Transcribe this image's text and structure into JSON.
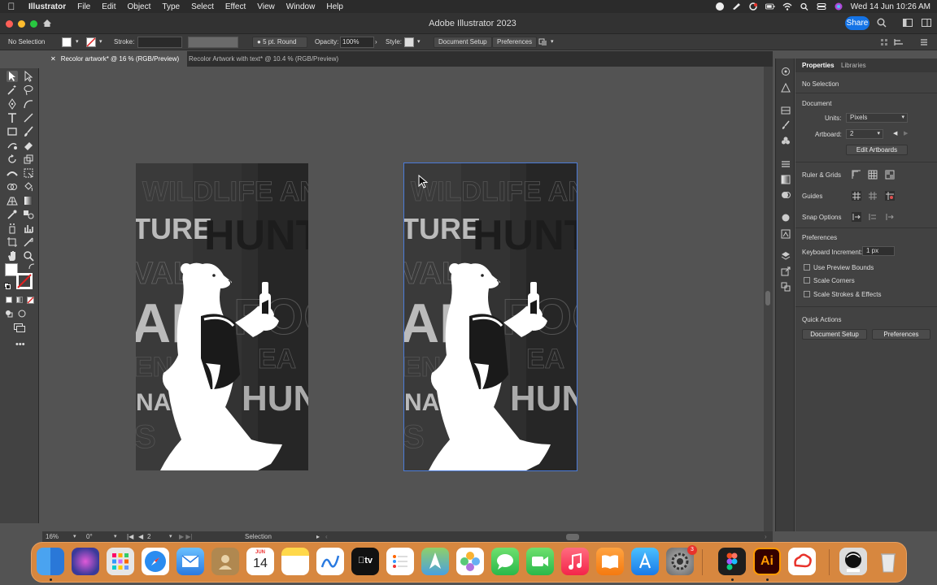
{
  "menubar": {
    "app_name": "Illustrator",
    "items": [
      "File",
      "Edit",
      "Object",
      "Type",
      "Select",
      "Effect",
      "View",
      "Window",
      "Help"
    ],
    "clock": "Wed 14 Jun  10:26 AM"
  },
  "window": {
    "title": "Adobe Illustrator 2023",
    "share_label": "Share"
  },
  "control_bar": {
    "selection_status": "No Selection",
    "stroke_label": "Stroke:",
    "brush_label": "5 pt. Round",
    "opacity_label": "Opacity:",
    "opacity_value": "100%",
    "style_label": "Style:",
    "document_setup_label": "Document Setup",
    "preferences_label": "Preferences"
  },
  "tabs": [
    {
      "label": "Recolor artwork* @ 16 % (RGB/Preview)",
      "active": true
    },
    {
      "label": "Recolor Artwork with text* @ 10.4 % (RGB/Preview)",
      "active": false
    }
  ],
  "artwork": {
    "text_rows": [
      {
        "text": "WILDLIFE  AN",
        "style": "outline"
      },
      {
        "text": "TURE",
        "style": "light"
      },
      {
        "text": "HUNTI",
        "style": "dark"
      },
      {
        "text": "VAL",
        "style": "outline"
      },
      {
        "text": "AR",
        "style": "light"
      },
      {
        "text": "FOO",
        "style": "outline"
      },
      {
        "text": "EN",
        "style": "outline"
      },
      {
        "text": "EA",
        "style": "outline"
      },
      {
        "text": "NATU",
        "style": "light"
      },
      {
        "text": "HUN",
        "style": "light"
      },
      {
        "text": "S",
        "style": "outline"
      }
    ]
  },
  "status_bar": {
    "zoom": "16%",
    "rotation": "0°",
    "artboard_number": "2",
    "tool": "Selection"
  },
  "properties_panel": {
    "tab_properties": "Properties",
    "tab_libraries": "Libraries",
    "no_selection": "No Selection",
    "document_section": "Document",
    "units_label": "Units:",
    "units_value": "Pixels",
    "artboard_label": "Artboard:",
    "artboard_value": "2",
    "edit_artboards_label": "Edit Artboards",
    "ruler_grids_label": "Ruler & Grids",
    "guides_label": "Guides",
    "snap_options_label": "Snap Options",
    "preferences_section": "Preferences",
    "keyboard_increment_label": "Keyboard Increment:",
    "keyboard_increment_value": "1 px",
    "use_preview_bounds": "Use Preview Bounds",
    "scale_corners": "Scale Corners",
    "scale_strokes": "Scale Strokes & Effects",
    "quick_actions_section": "Quick Actions",
    "document_setup_label": "Document Setup",
    "preferences_button": "Preferences"
  },
  "dock": {
    "calendar_month": "JUN",
    "calendar_day": "14",
    "settings_badge": "3",
    "illustrator_label": "Ai"
  },
  "colors": {
    "accent": "#1473e6",
    "canvas": "#535353",
    "artboard_bg": "#2e2e2e",
    "dock": "#d7873f"
  }
}
